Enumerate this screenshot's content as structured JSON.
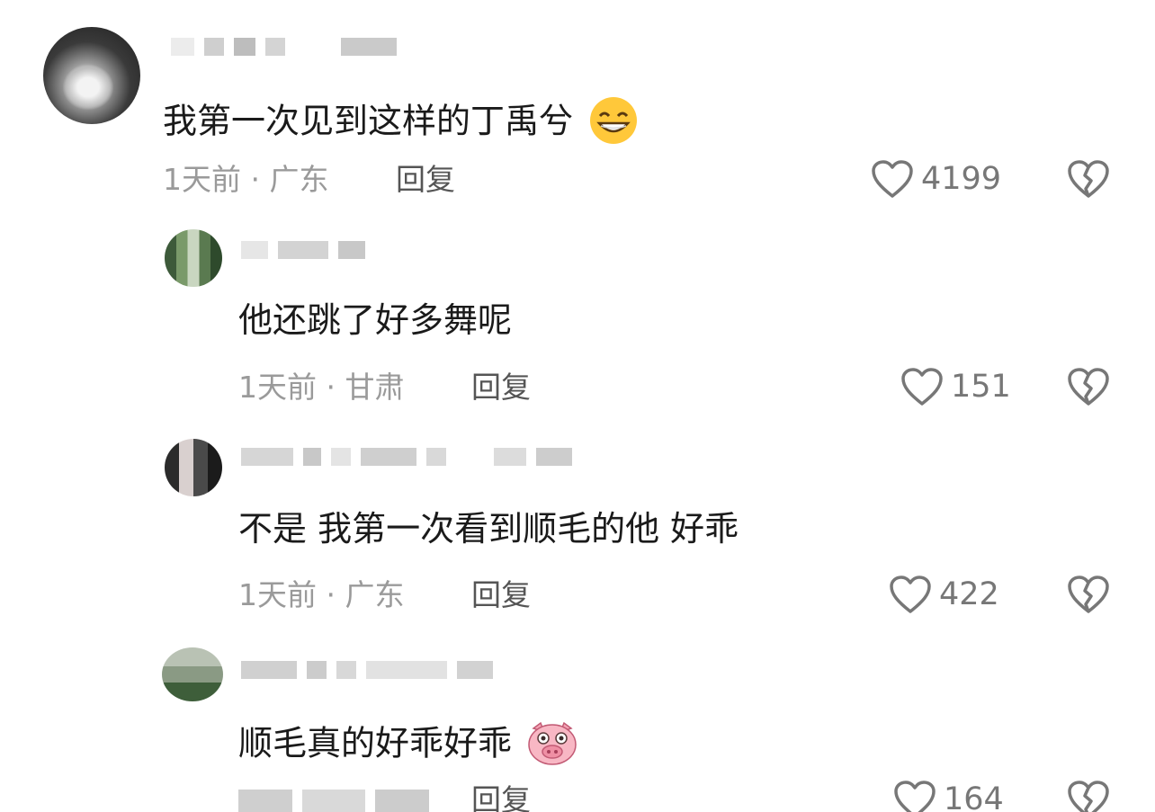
{
  "comments": [
    {
      "text": "我第一次见到这样的丁禹兮",
      "emoji": "grinning-face-emoji",
      "meta": "1天前 · 广东",
      "reply": "回复",
      "likes": "4199"
    },
    {
      "text": "他还跳了好多舞呢",
      "meta": "1天前 · 甘肃",
      "reply": "回复",
      "likes": "151"
    },
    {
      "text": "不是 我第一次看到顺毛的他 好乖",
      "meta": "1天前 · 广东",
      "reply": "回复",
      "likes": "422"
    },
    {
      "text": "顺毛真的好乖好乖",
      "emoji": "pig-face-emoji",
      "meta": "",
      "reply": "回复",
      "likes": "164"
    }
  ],
  "icons": {
    "like": "heart-outline-icon",
    "dislike": "broken-heart-icon"
  },
  "colors": {
    "text": "#1a1a1a",
    "meta": "#9a9a9a",
    "icon": "#777777"
  }
}
